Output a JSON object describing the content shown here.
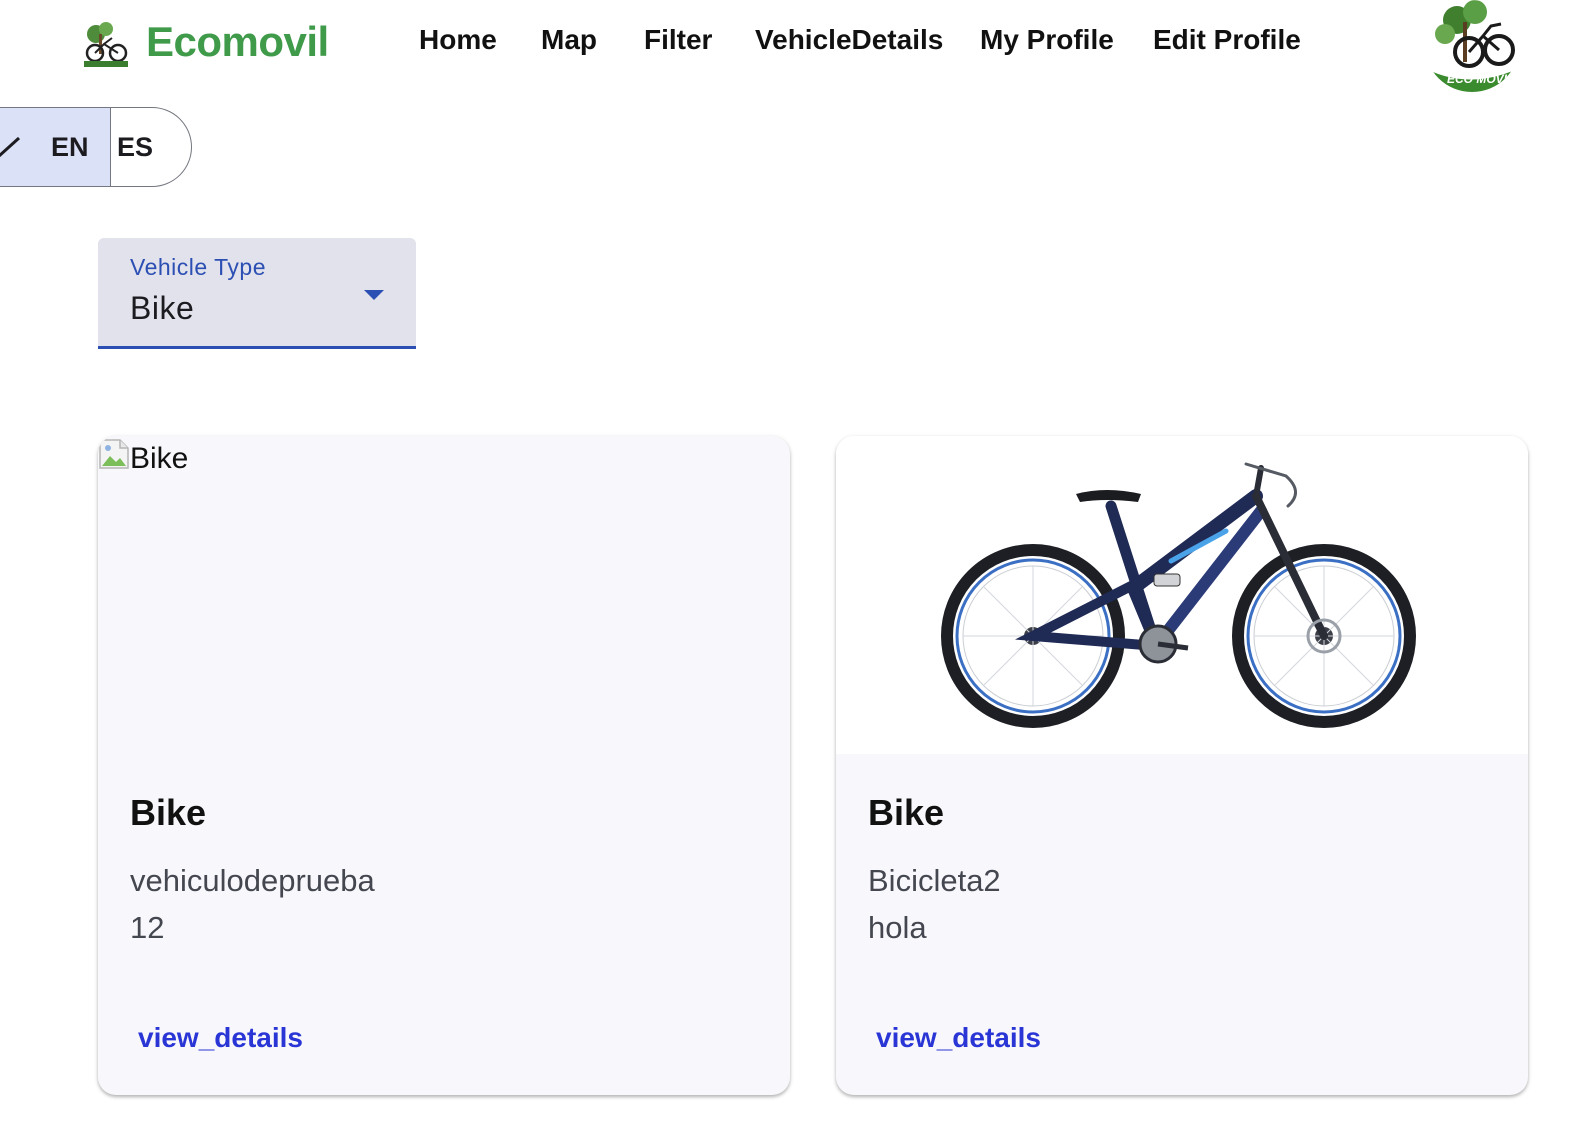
{
  "header": {
    "brand": "Ecomovil",
    "brand_color": "#3f9a4a",
    "logo_icon": "bike-tree-logo-icon",
    "nav": [
      "Home",
      "Map",
      "Filter",
      "VehicleDetails",
      "My Profile",
      "Edit Profile"
    ],
    "avatar_icon": "eco-movil-avatar-icon",
    "logo_text": "ECO MOVIL"
  },
  "language_toggle": {
    "options": [
      "EN",
      "ES"
    ],
    "selected": "EN",
    "selected_icon": "check-icon"
  },
  "filter": {
    "label": "Vehicle Type",
    "value": "Bike",
    "accent": "#2c4fb3"
  },
  "cards": [
    {
      "image_alt": "Bike",
      "image_state": "broken",
      "title": "Bike",
      "line1": "vehiculodeprueba",
      "line2": "12",
      "action": "view_details"
    },
    {
      "image_alt": "Bike",
      "image_state": "mountain-bike-photo",
      "title": "Bike",
      "line1": "Bicicleta2",
      "line2": "hola",
      "action": "view_details"
    }
  ],
  "colors": {
    "link": "#2a35d6",
    "card_bg": "#f8f8fc",
    "toggle_selected_bg": "#dbe1f7"
  }
}
